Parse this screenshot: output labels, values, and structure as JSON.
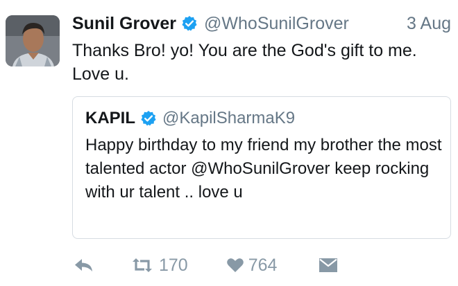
{
  "tweet": {
    "author_name": "Sunil Grover",
    "author_handle": "@WhoSunilGrover",
    "date": "3 Aug",
    "text": "Thanks Bro! yo! You are the God's gift to me. Love u."
  },
  "quoted_tweet": {
    "author_name": "KAPIL",
    "author_handle": "@KapilSharmaK9",
    "text": "Happy birthday to my friend my brother the most talented actor @WhoSunilGrover keep rocking with ur talent .. love u"
  },
  "actions": {
    "reply_icon": "reply-icon",
    "retweet_icon": "retweet-icon",
    "retweet_count": "170",
    "like_icon": "heart-icon",
    "like_count": "764",
    "dm_icon": "envelope-icon"
  },
  "colors": {
    "verified_badge": "#1da1f2",
    "secondary_text": "#657786",
    "action_icons": "#8899a6",
    "quote_border": "#d6dce2"
  }
}
